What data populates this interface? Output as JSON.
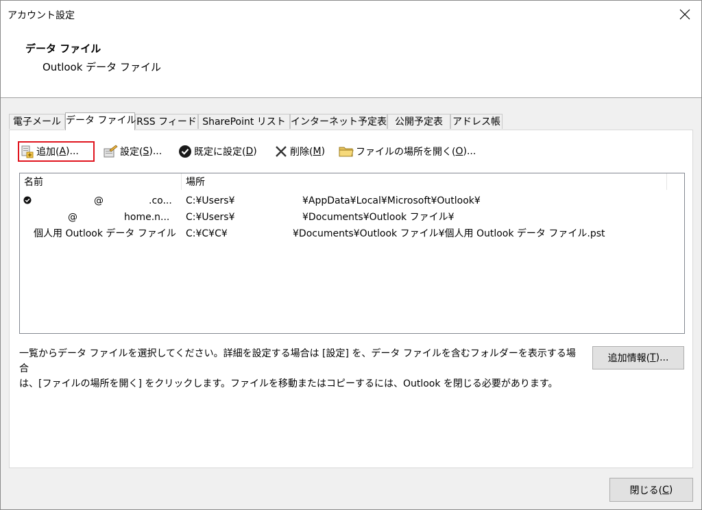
{
  "window": {
    "title": "アカウント設定"
  },
  "header": {
    "title": "データ ファイル",
    "subtitle": "Outlook データ ファイル"
  },
  "tabs": [
    {
      "label": "電子メール"
    },
    {
      "label": "データ ファイル",
      "active": true
    },
    {
      "label": "RSS フィード"
    },
    {
      "label": "SharePoint リスト"
    },
    {
      "label": "インターネット予定表"
    },
    {
      "label": "公開予定表"
    },
    {
      "label": "アドレス帳"
    }
  ],
  "toolbar": {
    "add": {
      "label": "追加(",
      "key": "A",
      "suffix": ")...",
      "icon": "add-data-file-icon"
    },
    "settings": {
      "label": "設定(",
      "key": "S",
      "suffix": ")...",
      "icon": "settings-icon"
    },
    "set_default": {
      "label": "既定に設定(",
      "key": "D",
      "suffix": ")",
      "icon": "checkmark-circle-icon"
    },
    "delete": {
      "label": "削除(",
      "key": "M",
      "suffix": ")",
      "icon": "delete-x-icon"
    },
    "open_location": {
      "label": "ファイルの場所を開く(",
      "key": "O",
      "suffix": ")...",
      "icon": "folder-icon"
    }
  },
  "list": {
    "columns": {
      "name": "名前",
      "location": "場所"
    },
    "rows": [
      {
        "default": true,
        "name": "@ .co...",
        "location": "C:¥Users¥ ¥AppData¥Local¥Microsoft¥Outlook¥"
      },
      {
        "default": false,
        "name": "@ home.n...",
        "location": "C:¥Users¥ ¥Documents¥Outlook ファイル¥"
      },
      {
        "default": false,
        "name": "個人用 Outlook データ ファイル",
        "location": "C:¥C¥C¥ ¥Documents¥Outlook ファイル¥個人用 Outlook データ ファイル.pst"
      }
    ],
    "row_parts": [
      {
        "name_a": "@",
        "name_b": ".co...",
        "loc_a": "C:¥Users¥",
        "loc_b": "¥AppData¥Local¥Microsoft¥Outlook¥"
      },
      {
        "name_a": "@",
        "name_b": "home.n...",
        "loc_a": "C:¥Users¥",
        "loc_b": "¥Documents¥Outlook ファイル¥"
      },
      {
        "name_a": "",
        "name_b": "個人用 Outlook データ ファイル",
        "loc_a": "C:¥C¥C¥",
        "loc_b": "¥Documents¥Outlook ファイル¥個人用 Outlook データ ファイル.pst"
      }
    ]
  },
  "info": {
    "line1": "一覧からデータ ファイルを選択してください。詳細を設定する場合は [設定] を、データ ファイルを含むフォルダーを表示する場合",
    "line2": "は、[ファイルの場所を開く] をクリックします。ファイルを移動またはコピーするには、Outlook を閉じる必要があります。"
  },
  "more_info": {
    "label": "追加情報(",
    "key": "T",
    "suffix": ")..."
  },
  "close_button": {
    "label": "閉じる(",
    "key": "C",
    "suffix": ")"
  },
  "colors": {
    "highlight_border": "#e0141e",
    "panel_bg": "#ffffff",
    "dialog_bg": "#f0f0f0"
  }
}
